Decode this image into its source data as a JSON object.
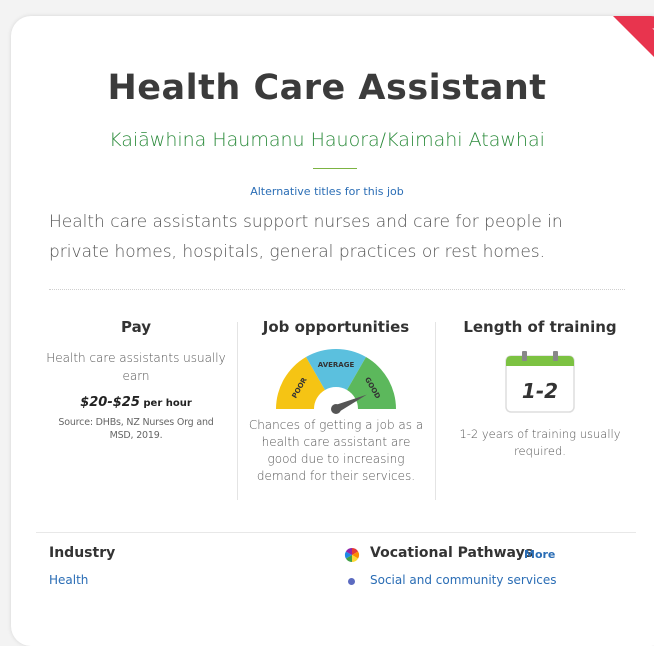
{
  "header": {
    "title": "Health Care Assistant",
    "maori_title": "Kaiāwhina Haumanu Hauora/Kaimahi Atawhai",
    "alt_titles_link": "Alternative titles for this job",
    "favourite_icon": "star-outline-icon"
  },
  "summary": "Health care assistants support nurses and care for people in private homes, hospitals, general practices or rest homes.",
  "pay": {
    "title": "Pay",
    "description": "Health care assistants usually earn",
    "range": "$20-$25",
    "unit": "per hour",
    "source": "Source: DHBs, NZ Nurses Org and MSD, 2019."
  },
  "jobs": {
    "title": "Job opportunities",
    "gauge_labels": {
      "poor": "POOR",
      "average": "AVERAGE",
      "good": "GOOD"
    },
    "gauge_level": "good",
    "description": "Chances of getting a job as a health care assistant are good due to increasing demand for their services."
  },
  "training": {
    "title": "Length of training",
    "calendar_value": "1-2",
    "description": "1-2 years of training usually required."
  },
  "industry": {
    "heading": "Industry",
    "link": "Health"
  },
  "vocational": {
    "heading": "Vocational Pathways",
    "more": "More",
    "item": "Social and community services",
    "icon": "vocational-pathways-icon"
  },
  "colors": {
    "favourite": "#e8344e",
    "maori_title": "#2a8a3a",
    "link": "#2a6db5",
    "gauge_poor": "#f5c414",
    "gauge_average": "#5bc0de",
    "gauge_good": "#5cb85c",
    "calendar_top": "#7cc242",
    "bullet": "#5c6bc0"
  }
}
